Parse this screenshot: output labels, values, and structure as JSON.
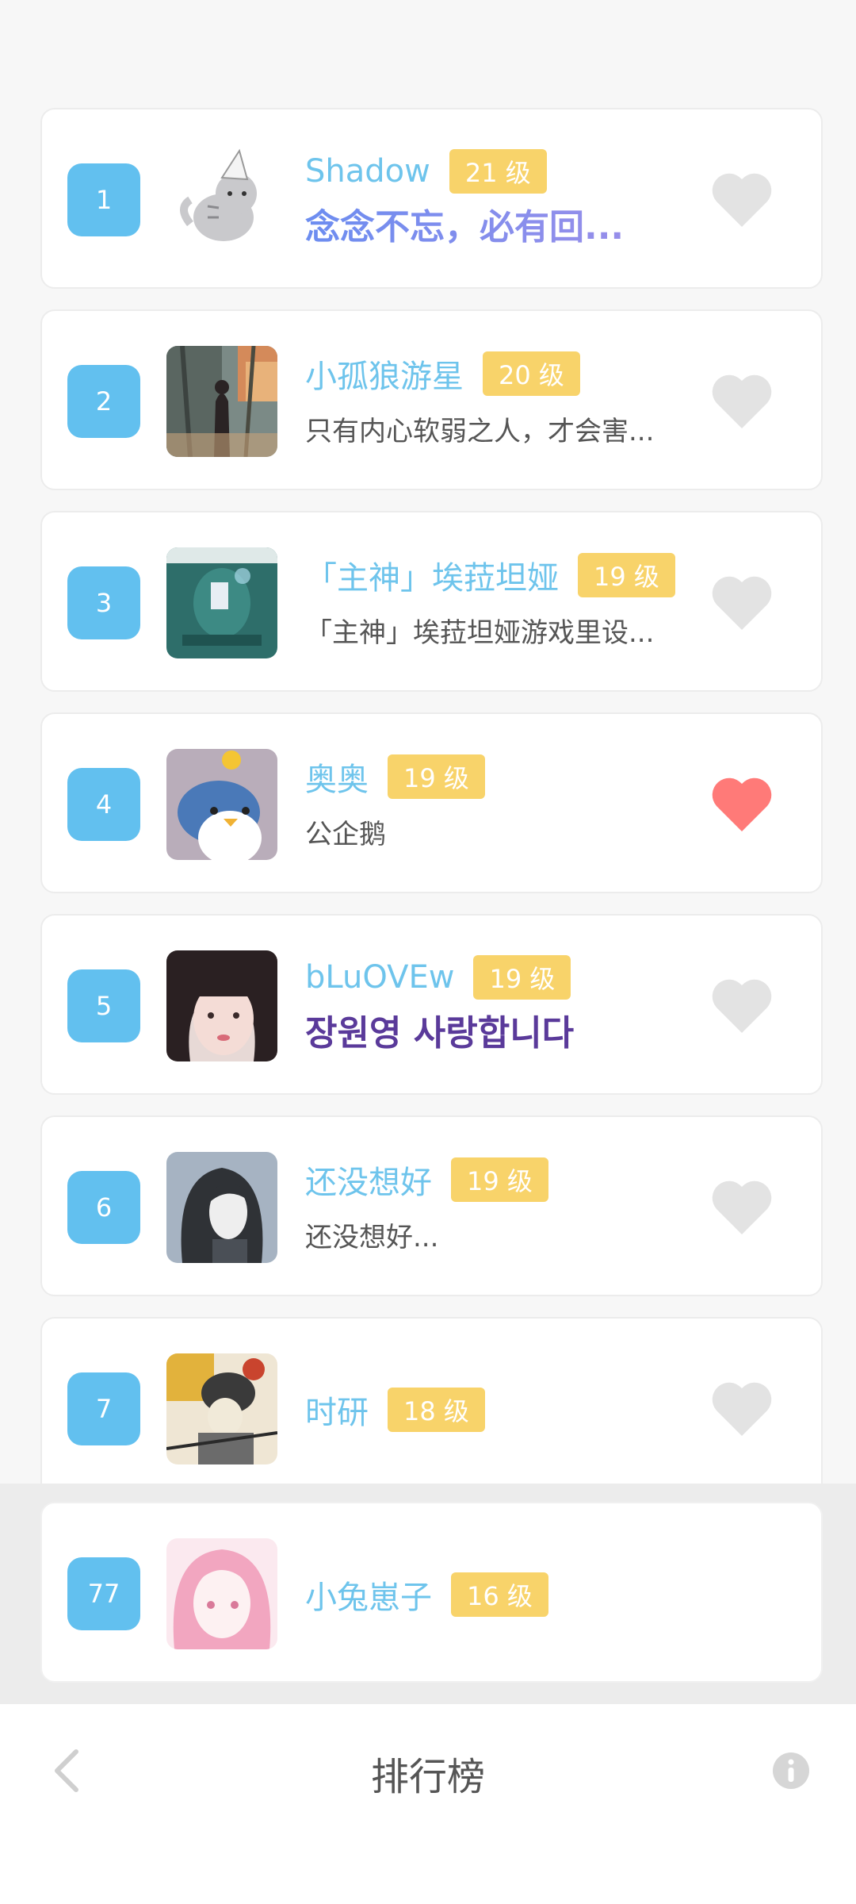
{
  "page": {
    "title": "排行榜"
  },
  "colors": {
    "rank_bg": "#62c0ef",
    "level_bg": "#f8d36a",
    "name": "#6ec4ec",
    "heart_liked": "#ff7a78",
    "heart_default": "#e3e3e3"
  },
  "ranking": [
    {
      "rank": "1",
      "name": "Shadow",
      "level": "21 级",
      "signature": "念念不忘，必有回...",
      "liked": false,
      "avatar_icon": "cat-icon"
    },
    {
      "rank": "2",
      "name": "小孤狼游星",
      "level": "20 级",
      "signature": "只有内心软弱之人，才会害...",
      "liked": false,
      "avatar_icon": "forest-figure-icon"
    },
    {
      "rank": "3",
      "name": "「主神」埃菈坦娅",
      "level": "19 级",
      "signature": "「主神」埃菈坦娅游戏里设...",
      "liked": false,
      "avatar_icon": "game-screen-icon"
    },
    {
      "rank": "4",
      "name": "奥奥",
      "level": "19 级",
      "signature": "公企鹅",
      "liked": true,
      "avatar_icon": "penguin-icon"
    },
    {
      "rank": "5",
      "name": "bLuOVEw",
      "level": "19 级",
      "signature": "장원영 사랑합니다",
      "liked": false,
      "avatar_icon": "portrait-icon"
    },
    {
      "rank": "6",
      "name": "还没想好",
      "level": "19 级",
      "signature": "还没想好...",
      "liked": false,
      "avatar_icon": "dark-hair-icon"
    },
    {
      "rank": "7",
      "name": "时研",
      "level": "18 级",
      "signature": "",
      "liked": false,
      "avatar_icon": "illustration-icon"
    }
  ],
  "me": {
    "rank": "77",
    "name": "小兔崽子",
    "level": "16 级",
    "avatar_icon": "pink-hair-icon"
  }
}
